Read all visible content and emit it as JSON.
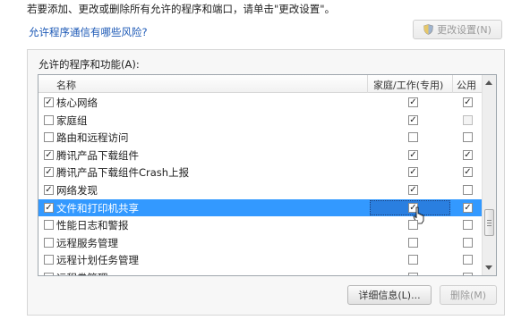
{
  "intro_text": "若要添加、更改或删除所有允许的程序和端口，请单击\"更改设置\"。",
  "risk_link": "允许程序通信有哪些风险?",
  "change_settings_button": "更改设置(N)",
  "group_title": "允许的程序和功能(A):",
  "columns": {
    "name": "名称",
    "home": "家庭/工作(专用)",
    "public": "公用"
  },
  "check_glyph": "✓",
  "rows": [
    {
      "label": "核心网络",
      "checked": true,
      "home": true,
      "public": true,
      "public_disabled": false,
      "selected": false
    },
    {
      "label": "家庭组",
      "checked": false,
      "home": true,
      "public": false,
      "public_disabled": true,
      "selected": false
    },
    {
      "label": "路由和远程访问",
      "checked": false,
      "home": false,
      "public": false,
      "public_disabled": false,
      "selected": false
    },
    {
      "label": "腾讯产品下载组件",
      "checked": true,
      "home": true,
      "public": true,
      "public_disabled": false,
      "selected": false
    },
    {
      "label": "腾讯产品下载组件Crash上报",
      "checked": true,
      "home": true,
      "public": true,
      "public_disabled": false,
      "selected": false
    },
    {
      "label": "网络发现",
      "checked": true,
      "home": true,
      "public": false,
      "public_disabled": false,
      "selected": false
    },
    {
      "label": "文件和打印机共享",
      "checked": true,
      "home": true,
      "public": true,
      "public_disabled": false,
      "selected": true
    },
    {
      "label": "性能日志和警报",
      "checked": false,
      "home": false,
      "public": false,
      "public_disabled": false,
      "selected": false
    },
    {
      "label": "远程服务管理",
      "checked": false,
      "home": false,
      "public": false,
      "public_disabled": false,
      "selected": false
    },
    {
      "label": "远程计划任务管理",
      "checked": false,
      "home": false,
      "public": false,
      "public_disabled": false,
      "selected": false
    },
    {
      "label": "远程卷管理",
      "checked": false,
      "home": false,
      "public": false,
      "public_disabled": false,
      "selected": false
    }
  ],
  "details_button": "详细信息(L)...",
  "delete_button": "删除(M)"
}
